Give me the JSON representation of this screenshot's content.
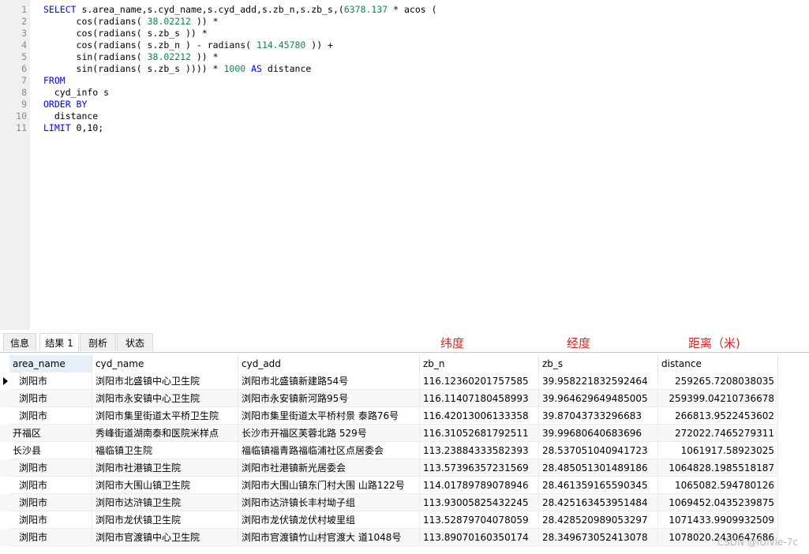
{
  "editor": {
    "lines": [
      [
        {
          "t": "SELECT",
          "c": "kw"
        },
        {
          "t": " s.area_name,s.cyd_name,s.cyd_add,s.zb_n,s.zb_s,("
        },
        {
          "t": "6378.137",
          "c": "num"
        },
        {
          "t": " * acos ("
        }
      ],
      [
        {
          "t": "      cos(radians( "
        },
        {
          "t": "38.02212",
          "c": "num"
        },
        {
          "t": " )) *"
        }
      ],
      [
        {
          "t": "      cos(radians( s.zb_s )) *"
        }
      ],
      [
        {
          "t": "      cos(radians( s.zb_n ) - radians( "
        },
        {
          "t": "114.45780",
          "c": "num"
        },
        {
          "t": " )) +"
        }
      ],
      [
        {
          "t": "      sin(radians( "
        },
        {
          "t": "38.02212",
          "c": "num"
        },
        {
          "t": " )) *"
        }
      ],
      [
        {
          "t": "      sin(radians( s.zb_s )))) * "
        },
        {
          "t": "1000",
          "c": "num"
        },
        {
          "t": " "
        },
        {
          "t": "AS",
          "c": "kw"
        },
        {
          "t": " distance"
        }
      ],
      [
        {
          "t": "FROM",
          "c": "kw"
        }
      ],
      [
        {
          "t": "  cyd_info s"
        }
      ],
      [
        {
          "t": "ORDER BY",
          "c": "kw"
        }
      ],
      [
        {
          "t": "  distance"
        }
      ],
      [
        {
          "t": "LIMIT",
          "c": "kw"
        },
        {
          "t": " 0,10;"
        }
      ]
    ]
  },
  "tabs": [
    "信息",
    "结果 1",
    "剖析",
    "状态"
  ],
  "annotations": {
    "lat": "纬度",
    "lng": "经度",
    "dist": "距离（米)"
  },
  "columns": [
    "area_name",
    "cyd_name",
    "cyd_add",
    "zb_n",
    "zb_s",
    "distance"
  ],
  "rows": [
    [
      "浏阳市",
      "浏阳市北盛镇中心卫生院",
      "浏阳市北盛镇新建路54号",
      "116.12360201757585",
      "39.958221832592464",
      "259265.7208038035"
    ],
    [
      "浏阳市",
      "浏阳市永安镇中心卫生院",
      "浏阳市永安镇新河路95号",
      "116.11407180458993",
      "39.964629649485005",
      "259399.04210736678"
    ],
    [
      "浏阳市",
      "浏阳市集里街道太平桥卫生院",
      "浏阳市集里街道太平桥村景 泰路76号",
      "116.42013006133358",
      "39.87043733296683",
      "266813.9522453602"
    ],
    [
      "开福区",
      "秀峰街道湖南泰和医院米样点",
      "长沙市开福区芙蓉北路 529号",
      "116.31052681792511",
      "39.99680640683696",
      "272022.7465279311"
    ],
    [
      "长沙县",
      "福临镇卫生院",
      "福临镇福青路福临浦社区点居委会",
      "113.23884333582393",
      "28.537051040941723",
      "1061917.58923025"
    ],
    [
      "浏阳市",
      "浏阳市社港镇卫生院",
      "浏阳市社港镇新光居委会",
      "113.57396357231569",
      "28.485051301489186",
      "1064828.1985518187"
    ],
    [
      "浏阳市",
      "浏阳市大围山镇卫生院",
      "浏阳市大围山镇东门村大围 山路122号",
      "114.01789789078946",
      "28.461359165590345",
      "1065082.594780126"
    ],
    [
      "浏阳市",
      "浏阳市达浒镇卫生院",
      "浏阳市达浒镇长丰村坳子组",
      "113.93005825432245",
      "28.425163453951484",
      "1069452.0435239875"
    ],
    [
      "浏阳市",
      "浏阳市龙伏镇卫生院",
      "浏阳市龙伏镇龙伏村坡里组",
      "113.52879704078059",
      "28.428520989053297",
      "1071433.9909932509"
    ],
    [
      "浏阳市",
      "浏阳市官渡镇中心卫生院",
      "浏阳市官渡镇竹山村官渡大 道1048号",
      "113.89070160350174",
      "28.349673052413078",
      "1078020.2430647686"
    ]
  ],
  "watermark": "CSDN @IUIvie-7c"
}
